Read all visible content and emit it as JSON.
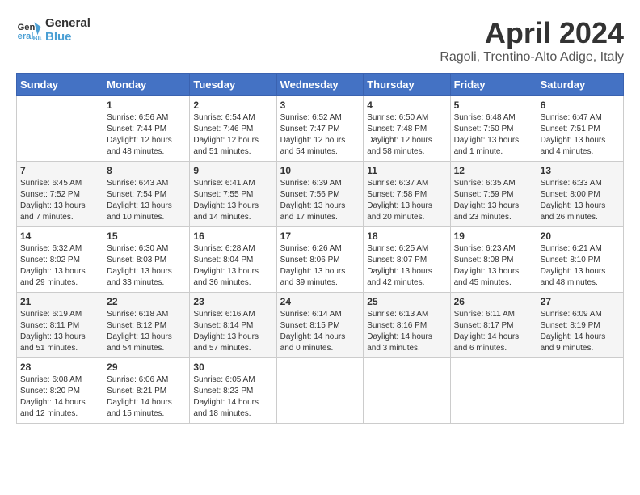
{
  "logo": {
    "line1": "General",
    "line2": "Blue"
  },
  "title": "April 2024",
  "subtitle": "Ragoli, Trentino-Alto Adige, Italy",
  "days_header": [
    "Sunday",
    "Monday",
    "Tuesday",
    "Wednesday",
    "Thursday",
    "Friday",
    "Saturday"
  ],
  "weeks": [
    [
      {
        "num": "",
        "info": ""
      },
      {
        "num": "1",
        "info": "Sunrise: 6:56 AM\nSunset: 7:44 PM\nDaylight: 12 hours and 48 minutes."
      },
      {
        "num": "2",
        "info": "Sunrise: 6:54 AM\nSunset: 7:46 PM\nDaylight: 12 hours and 51 minutes."
      },
      {
        "num": "3",
        "info": "Sunrise: 6:52 AM\nSunset: 7:47 PM\nDaylight: 12 hours and 54 minutes."
      },
      {
        "num": "4",
        "info": "Sunrise: 6:50 AM\nSunset: 7:48 PM\nDaylight: 12 hours and 58 minutes."
      },
      {
        "num": "5",
        "info": "Sunrise: 6:48 AM\nSunset: 7:50 PM\nDaylight: 13 hours and 1 minute."
      },
      {
        "num": "6",
        "info": "Sunrise: 6:47 AM\nSunset: 7:51 PM\nDaylight: 13 hours and 4 minutes."
      }
    ],
    [
      {
        "num": "7",
        "info": "Sunrise: 6:45 AM\nSunset: 7:52 PM\nDaylight: 13 hours and 7 minutes."
      },
      {
        "num": "8",
        "info": "Sunrise: 6:43 AM\nSunset: 7:54 PM\nDaylight: 13 hours and 10 minutes."
      },
      {
        "num": "9",
        "info": "Sunrise: 6:41 AM\nSunset: 7:55 PM\nDaylight: 13 hours and 14 minutes."
      },
      {
        "num": "10",
        "info": "Sunrise: 6:39 AM\nSunset: 7:56 PM\nDaylight: 13 hours and 17 minutes."
      },
      {
        "num": "11",
        "info": "Sunrise: 6:37 AM\nSunset: 7:58 PM\nDaylight: 13 hours and 20 minutes."
      },
      {
        "num": "12",
        "info": "Sunrise: 6:35 AM\nSunset: 7:59 PM\nDaylight: 13 hours and 23 minutes."
      },
      {
        "num": "13",
        "info": "Sunrise: 6:33 AM\nSunset: 8:00 PM\nDaylight: 13 hours and 26 minutes."
      }
    ],
    [
      {
        "num": "14",
        "info": "Sunrise: 6:32 AM\nSunset: 8:02 PM\nDaylight: 13 hours and 29 minutes."
      },
      {
        "num": "15",
        "info": "Sunrise: 6:30 AM\nSunset: 8:03 PM\nDaylight: 13 hours and 33 minutes."
      },
      {
        "num": "16",
        "info": "Sunrise: 6:28 AM\nSunset: 8:04 PM\nDaylight: 13 hours and 36 minutes."
      },
      {
        "num": "17",
        "info": "Sunrise: 6:26 AM\nSunset: 8:06 PM\nDaylight: 13 hours and 39 minutes."
      },
      {
        "num": "18",
        "info": "Sunrise: 6:25 AM\nSunset: 8:07 PM\nDaylight: 13 hours and 42 minutes."
      },
      {
        "num": "19",
        "info": "Sunrise: 6:23 AM\nSunset: 8:08 PM\nDaylight: 13 hours and 45 minutes."
      },
      {
        "num": "20",
        "info": "Sunrise: 6:21 AM\nSunset: 8:10 PM\nDaylight: 13 hours and 48 minutes."
      }
    ],
    [
      {
        "num": "21",
        "info": "Sunrise: 6:19 AM\nSunset: 8:11 PM\nDaylight: 13 hours and 51 minutes."
      },
      {
        "num": "22",
        "info": "Sunrise: 6:18 AM\nSunset: 8:12 PM\nDaylight: 13 hours and 54 minutes."
      },
      {
        "num": "23",
        "info": "Sunrise: 6:16 AM\nSunset: 8:14 PM\nDaylight: 13 hours and 57 minutes."
      },
      {
        "num": "24",
        "info": "Sunrise: 6:14 AM\nSunset: 8:15 PM\nDaylight: 14 hours and 0 minutes."
      },
      {
        "num": "25",
        "info": "Sunrise: 6:13 AM\nSunset: 8:16 PM\nDaylight: 14 hours and 3 minutes."
      },
      {
        "num": "26",
        "info": "Sunrise: 6:11 AM\nSunset: 8:17 PM\nDaylight: 14 hours and 6 minutes."
      },
      {
        "num": "27",
        "info": "Sunrise: 6:09 AM\nSunset: 8:19 PM\nDaylight: 14 hours and 9 minutes."
      }
    ],
    [
      {
        "num": "28",
        "info": "Sunrise: 6:08 AM\nSunset: 8:20 PM\nDaylight: 14 hours and 12 minutes."
      },
      {
        "num": "29",
        "info": "Sunrise: 6:06 AM\nSunset: 8:21 PM\nDaylight: 14 hours and 15 minutes."
      },
      {
        "num": "30",
        "info": "Sunrise: 6:05 AM\nSunset: 8:23 PM\nDaylight: 14 hours and 18 minutes."
      },
      {
        "num": "",
        "info": ""
      },
      {
        "num": "",
        "info": ""
      },
      {
        "num": "",
        "info": ""
      },
      {
        "num": "",
        "info": ""
      }
    ]
  ]
}
